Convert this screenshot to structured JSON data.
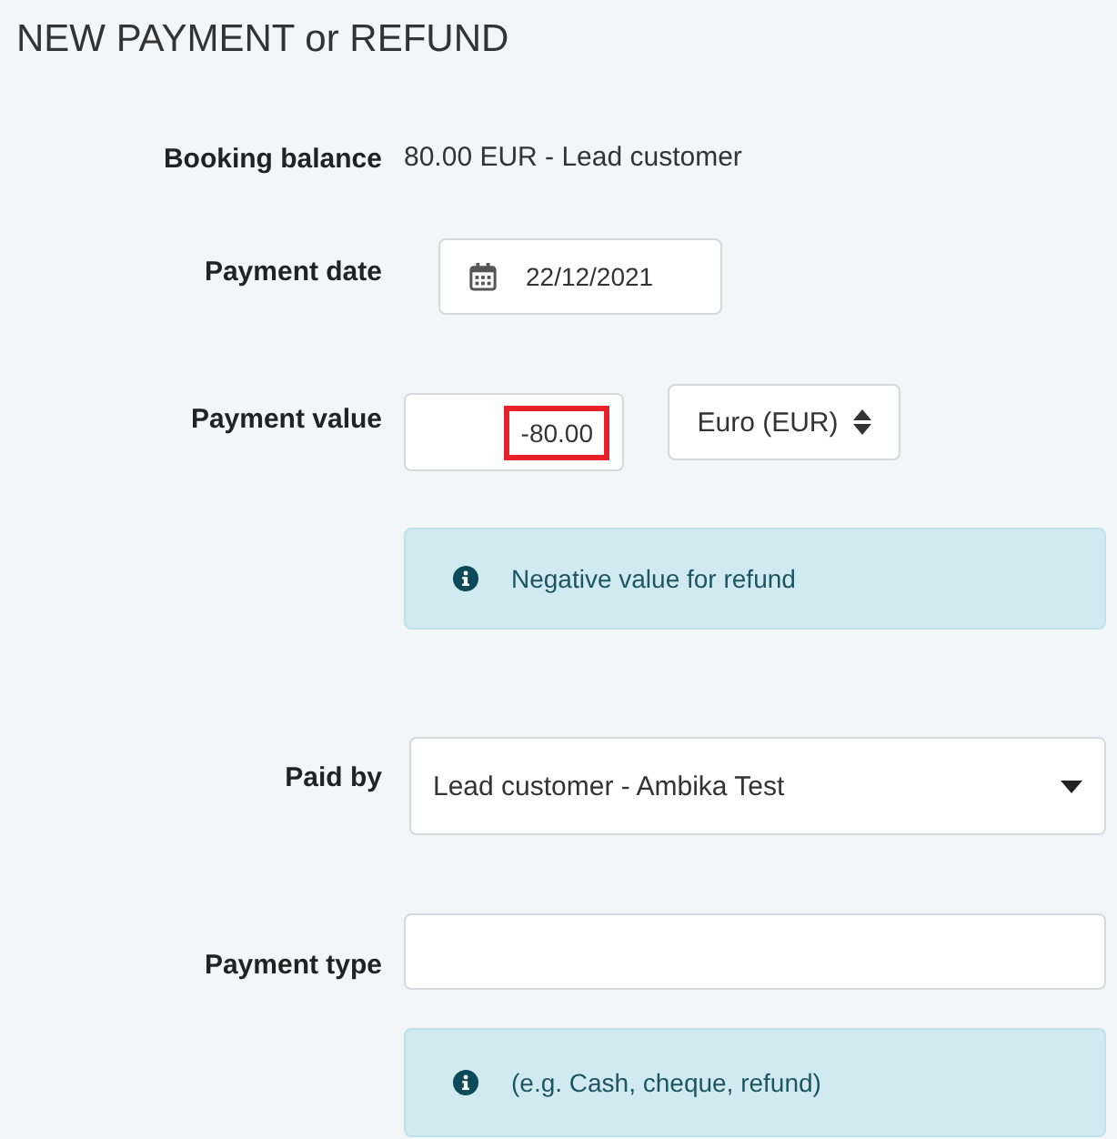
{
  "title": "NEW PAYMENT or REFUND",
  "fields": [
    {
      "kind": "text",
      "label": "Booking balance",
      "value": "80.00 EUR - Lead customer"
    },
    {
      "kind": "date",
      "label": "Payment date",
      "value": "22/12/2021"
    },
    {
      "kind": "amount",
      "label": "Payment value",
      "value": "-80.00",
      "highlighted": true,
      "currency": "Euro (EUR)",
      "hint": "Negative value for refund"
    },
    {
      "kind": "select",
      "label": "Paid by",
      "value": "Lead customer - Ambika Test"
    },
    {
      "kind": "input",
      "label": "Payment type",
      "hint": "(e.g. Cash, cheque, refund)"
    }
  ]
}
